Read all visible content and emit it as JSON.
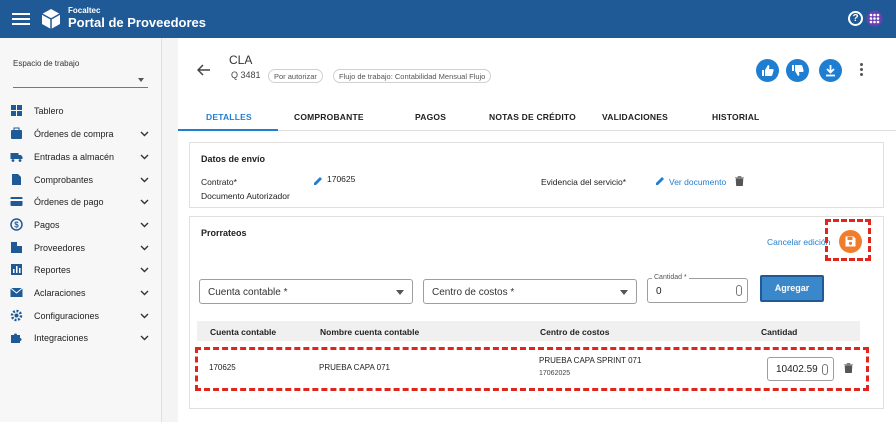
{
  "header": {
    "brand_small": "Focaltec",
    "brand_big": "Portal de Proveedores",
    "icons": [
      "menu-icon",
      "logo",
      "help-icon",
      "apps-icon"
    ]
  },
  "sidebar": {
    "workspace_label": "Espacio de trabajo",
    "workspace_value": "",
    "items": [
      {
        "label": "Tablero",
        "icon": "dashboard-icon",
        "has_chevron": false
      },
      {
        "label": "Órdenes de compra",
        "icon": "purchase-orders-icon",
        "has_chevron": true
      },
      {
        "label": "Entradas a almacén",
        "icon": "truck-icon",
        "has_chevron": true
      },
      {
        "label": "Comprobantes",
        "icon": "document-icon",
        "has_chevron": true
      },
      {
        "label": "Órdenes de pago",
        "icon": "card-icon",
        "has_chevron": true
      },
      {
        "label": "Pagos",
        "icon": "dollar-icon",
        "has_chevron": true
      },
      {
        "label": "Proveedores",
        "icon": "building-icon",
        "has_chevron": true
      },
      {
        "label": "Reportes",
        "icon": "report-icon",
        "has_chevron": true
      },
      {
        "label": "Aclaraciones",
        "icon": "mail-icon",
        "has_chevron": true
      },
      {
        "label": "Configuraciones",
        "icon": "gear-icon",
        "has_chevron": true
      },
      {
        "label": "Integraciones",
        "icon": "puzzle-icon",
        "has_chevron": true
      }
    ]
  },
  "document": {
    "title": "CLA",
    "code": "Q 3481",
    "status_chip": "Por autorizar",
    "workflow_chip": "Flujo de trabajo: Contabilidad Mensual Flujo"
  },
  "tabs": [
    {
      "label": "DETALLES",
      "active": true
    },
    {
      "label": "COMPROBANTE",
      "active": false
    },
    {
      "label": "PAGOS",
      "active": false
    },
    {
      "label": "NOTAS DE CRÉDITO",
      "active": false
    },
    {
      "label": "VALIDACIONES",
      "active": false
    },
    {
      "label": "HISTORIAL",
      "active": false
    }
  ],
  "shipping": {
    "title": "Datos de envío",
    "contract_label": "Contrato*",
    "contract_value": "170625",
    "authorized_doc": "Documento Autorizador",
    "evidence_label": "Evidencia del servicio*",
    "view_doc_link": "Ver documento"
  },
  "prorrateos": {
    "title": "Prorrateos",
    "cancel_link": "Cancelar edición",
    "account_placeholder": "Cuenta contable *",
    "cost_center_placeholder": "Centro de costos *",
    "qty_label": "Cantidad *",
    "qty_value": "0",
    "add_button": "Agregar",
    "columns": [
      "Cuenta contable",
      "Nombre cuenta contable",
      "Centro de costos",
      "Cantidad"
    ],
    "rows": [
      {
        "account": "170625",
        "account_name": "PRUEBA CAPA 071",
        "cost_center": "PRUEBA CAPA SPRINT 071",
        "cost_center_code": "17062025",
        "quantity": "10402.59"
      }
    ]
  },
  "colors": {
    "header_bg": "#1f5a96",
    "accent": "#1f7ed1",
    "save_fab": "#f07d2b",
    "highlight": "#e0261c"
  }
}
